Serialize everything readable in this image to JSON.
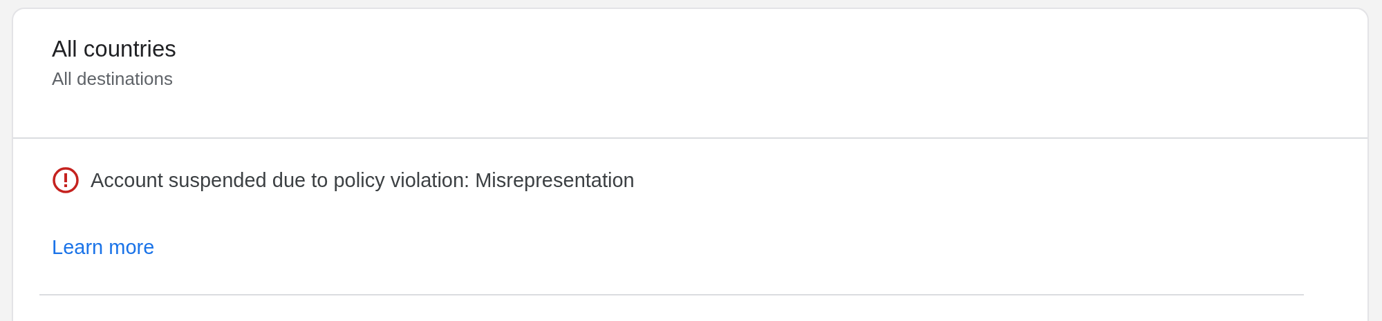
{
  "header": {
    "title": "All countries",
    "subtitle": "All destinations"
  },
  "issues": [
    {
      "kind": "error",
      "message": "Account suspended due to policy violation: Misrepresentation",
      "link": "Learn more"
    }
  ]
}
